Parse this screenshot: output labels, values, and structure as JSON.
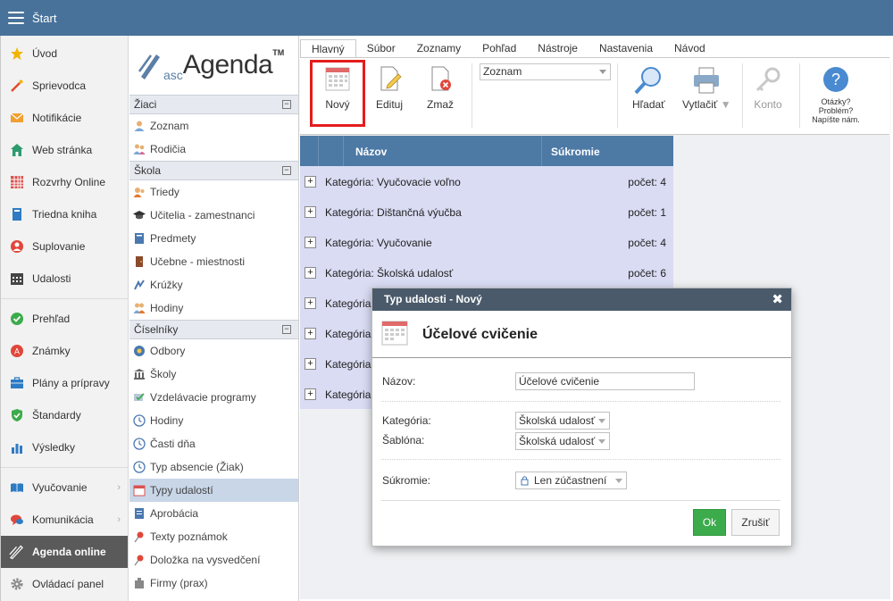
{
  "app": {
    "title": "Štart"
  },
  "leftnav": {
    "items": [
      {
        "label": "Úvod",
        "icon": "star-icon",
        "color": "#f2b400"
      },
      {
        "label": "Sprievodca",
        "icon": "magic-wand-icon",
        "color": "#e04b2a"
      },
      {
        "label": "Notifikácie",
        "icon": "envelope-icon",
        "color": "#f0a030"
      },
      {
        "label": "Web stránka",
        "icon": "home-icon",
        "color": "#2e9b6f"
      },
      {
        "label": "Rozvrhy Online",
        "icon": "timetable-icon",
        "color": "#d9534f"
      },
      {
        "label": "Triedna kniha",
        "icon": "book-icon",
        "color": "#2e7bc4"
      },
      {
        "label": "Suplovanie",
        "icon": "substitute-icon",
        "color": "#e0473a"
      },
      {
        "label": "Udalosti",
        "icon": "calendar-icon",
        "color": "#444444"
      },
      {
        "label": "Prehľad",
        "icon": "check-circle-icon",
        "color": "#3cab4b"
      },
      {
        "label": "Známky",
        "icon": "grades-icon",
        "color": "#e0473a"
      },
      {
        "label": "Plány a prípravy",
        "icon": "briefcase-icon",
        "color": "#2e7bc4"
      },
      {
        "label": "Štandardy",
        "icon": "shield-check-icon",
        "color": "#3cab4b"
      },
      {
        "label": "Výsledky",
        "icon": "bar-chart-icon",
        "color": "#2e7bc4"
      },
      {
        "label": "Vyučovanie",
        "icon": "open-book-icon",
        "color": "#2e7bc4"
      },
      {
        "label": "Komunikácia",
        "icon": "chat-icon",
        "color": "#e0473a"
      },
      {
        "label": "Agenda online",
        "icon": "agenda-icon",
        "color": "#ffffff"
      },
      {
        "label": "Ovládací panel",
        "icon": "gear-icon",
        "color": "#888888"
      }
    ]
  },
  "sidebar2": {
    "logo": {
      "prefix": "asc",
      "name": "Agenda",
      "tm": "TM"
    },
    "sections": [
      {
        "title": "Žiaci",
        "items": [
          "Zoznam",
          "Rodičia"
        ]
      },
      {
        "title": "Škola",
        "items": [
          "Triedy",
          "Učitelia - zamestnanci",
          "Predmety",
          "Učebne - miestnosti",
          "Krúžky",
          "Hodiny"
        ]
      },
      {
        "title": "Číselníky",
        "items": [
          "Odbory",
          "Školy",
          "Vzdelávacie programy",
          "Hodiny",
          "Časti dňa",
          "Typ absencie (Žiak)",
          "Typy udalostí",
          "Aprobácia",
          "Texty poznámok",
          "Doložka na vysvedčení",
          "Firmy (prax)"
        ]
      }
    ],
    "collapse_symbol": "−"
  },
  "ribbon": {
    "tabs": [
      "Hlavný",
      "Súbor",
      "Zoznamy",
      "Pohľad",
      "Nástroje",
      "Nastavenia",
      "Návod"
    ],
    "buttons": {
      "new": "Nový",
      "edit": "Edituj",
      "delete": "Zmaž",
      "search": "Hľadať",
      "print": "Vytlačiť",
      "account": "Konto",
      "help": "Otázky?\nProblém?\nNapíšte nám."
    },
    "view_select": "Zoznam"
  },
  "grid": {
    "columns": [
      "Názov",
      "Súkromie"
    ],
    "rows": [
      {
        "name": "Kategória: Vyučovacie voľno",
        "count": "počet: 4"
      },
      {
        "name": "Kategória: Dištančná výučba",
        "count": "počet: 1"
      },
      {
        "name": "Kategória: Vyučovanie",
        "count": "počet: 4"
      },
      {
        "name": "Kategória: Školská udalosť",
        "count": "počet: 6"
      },
      {
        "name": "Kategória",
        "count": ""
      },
      {
        "name": "Kategória",
        "count": ""
      },
      {
        "name": "Kategória",
        "count": ""
      },
      {
        "name": "Kategória",
        "count": ""
      }
    ],
    "expand_symbol": "+"
  },
  "modal": {
    "header": "Typ udalosti - Nový",
    "close": "✖",
    "title": "Účelové cvičenie",
    "fields": {
      "name_label": "Názov:",
      "name_value": "Účelové cvičenie",
      "category_label": "Kategória:",
      "category_value": "Školská udalosť",
      "template_label": "Šablóna:",
      "template_value": "Školská udalosť",
      "privacy_label": "Súkromie:",
      "privacy_value": "Len zúčastnení"
    },
    "ok": "Ok",
    "cancel": "Zrušiť"
  },
  "colors": {
    "topbar": "#48729a",
    "grid_header": "#4d79a5",
    "grid_row": "#d9dcf3",
    "ok": "#3cab4b",
    "highlight": "#e41d1d"
  }
}
